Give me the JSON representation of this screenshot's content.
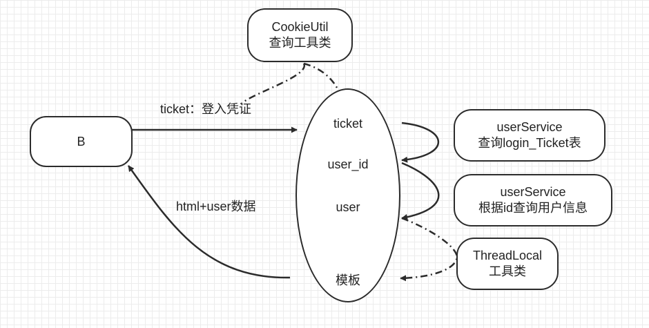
{
  "nodes": {
    "browser": {
      "label": "B"
    },
    "cookie_util": {
      "line1": "CookieUtil",
      "line2": "查询工具类"
    },
    "center": {
      "ticket": "ticket",
      "user_id": "user_id",
      "user": "user",
      "template": "模板"
    },
    "user_service_ticket": {
      "line1": "userService",
      "line2": "查询login_Ticket表"
    },
    "user_service_info": {
      "line1": "userService",
      "line2": "根据id查询用户信息"
    },
    "thread_local": {
      "line1": "ThreadLocal",
      "line2": "工具类"
    }
  },
  "edges": {
    "ticket_edge_label": "ticket：登入凭证",
    "response_edge_label": "html+user数据"
  },
  "colors": {
    "stroke": "#2b2b2b",
    "grid": "#ececec"
  }
}
